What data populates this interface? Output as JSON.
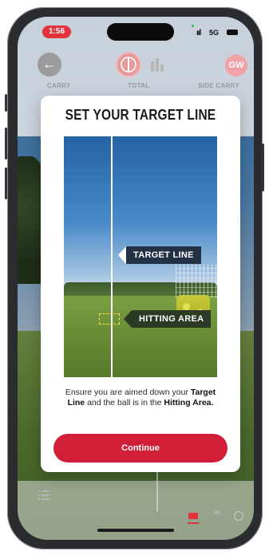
{
  "status_bar": {
    "time": "1:56",
    "signal": "ııl",
    "network": "5G"
  },
  "header": {
    "stats": {
      "carry": "CARRY",
      "total": "TOTAL",
      "side_carry": "SIDE CARRY"
    },
    "club_badge": "GW"
  },
  "modal": {
    "title": "SET YOUR TARGET LINE",
    "labels": {
      "target_line": "TARGET LINE",
      "hitting_area": "HITTING AREA"
    },
    "instruction": {
      "part1": "Ensure you are aimed down your ",
      "target_line_bold": "Target Line",
      "part2": " and the ball is in the ",
      "hitting_area_bold": "Hitting Area."
    },
    "continue_label": "Continue"
  },
  "bottom_bar": {
    "mode_label": "HD"
  },
  "colors": {
    "accent": "#d11f37",
    "tag_dark_blue": "#233146",
    "tag_dark_green": "#2a3a24"
  }
}
